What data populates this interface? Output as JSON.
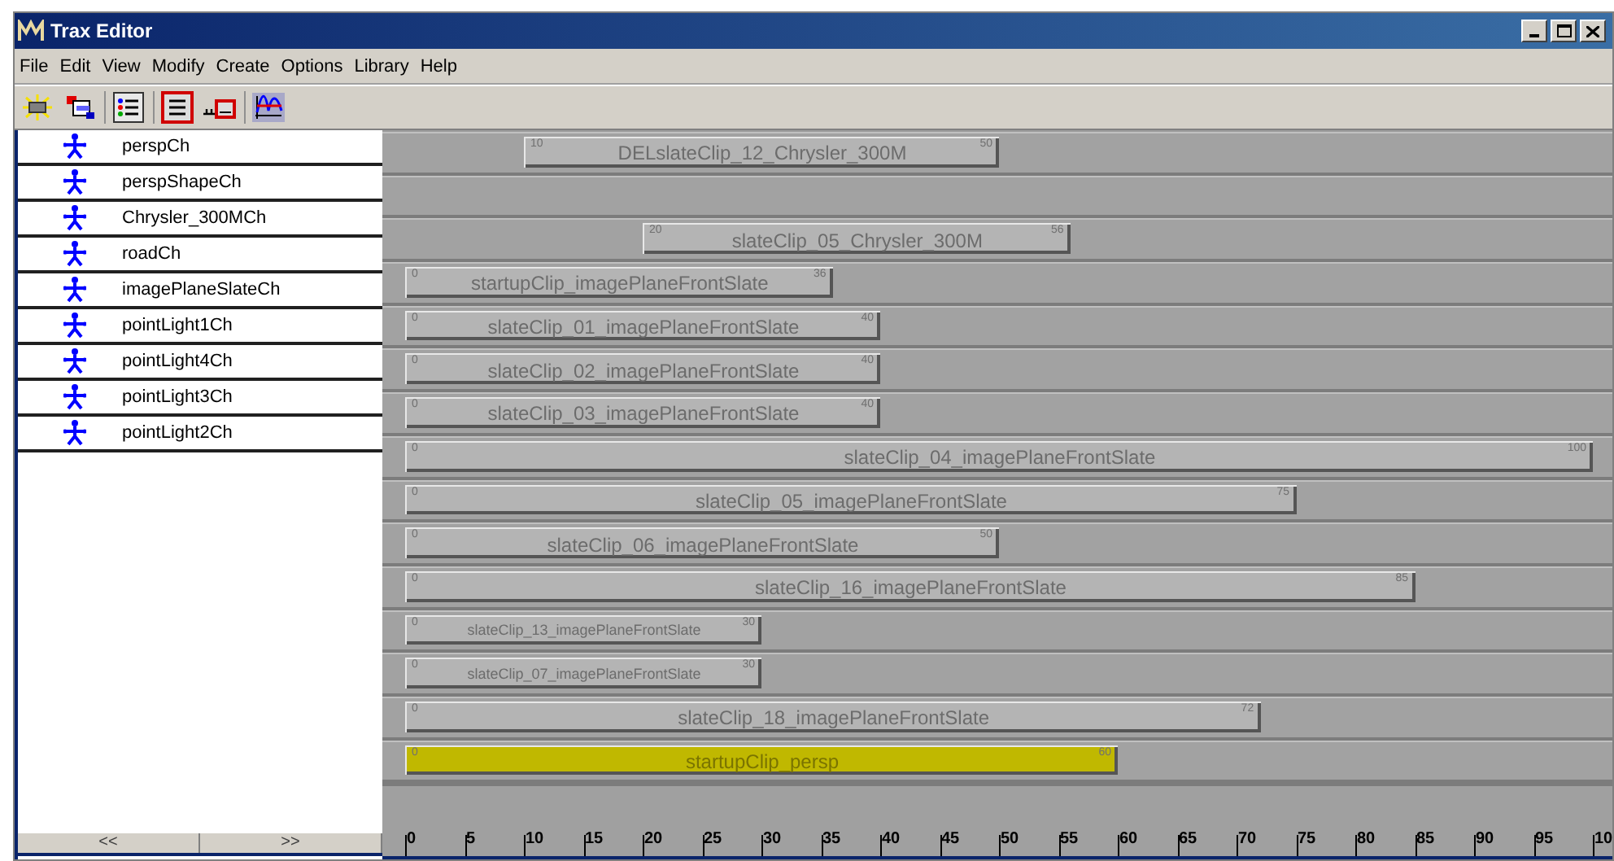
{
  "window": {
    "title": "Trax Editor"
  },
  "menu": [
    "File",
    "Edit",
    "View",
    "Modify",
    "Create",
    "Options",
    "Library",
    "Help"
  ],
  "characters": [
    "perspCh",
    "perspShapeCh",
    "Chrysler_300MCh",
    "roadCh",
    "imagePlaneSlateCh",
    "pointLight1Ch",
    "pointLight4Ch",
    "pointLight3Ch",
    "pointLight2Ch"
  ],
  "list_nav": [
    "<<",
    ">>"
  ],
  "tracks": [
    {
      "clips": [
        {
          "label": "DELslateClip_12_Chrysler_300M",
          "start": "10",
          "end": "50",
          "selected": false,
          "small": false
        }
      ]
    },
    {
      "kind": "empty"
    },
    {
      "clips": [
        {
          "label": "slateClip_05_Chrysler_300M",
          "start": "20",
          "end": "56",
          "selected": false,
          "small": false
        }
      ]
    },
    {
      "clips": [
        {
          "label": "startupClip_imagePlaneFrontSlate",
          "start": "0",
          "end": "36",
          "selected": false,
          "small": false
        }
      ]
    },
    {
      "clips": [
        {
          "label": "slateClip_01_imagePlaneFrontSlate",
          "start": "0",
          "end": "40",
          "selected": false,
          "small": false
        }
      ]
    },
    {
      "clips": [
        {
          "label": "slateClip_02_imagePlaneFrontSlate",
          "start": "0",
          "end": "40",
          "selected": false,
          "small": false
        }
      ]
    },
    {
      "clips": [
        {
          "label": "slateClip_03_imagePlaneFrontSlate",
          "start": "0",
          "end": "40",
          "selected": false,
          "small": false
        }
      ]
    },
    {
      "clips": [
        {
          "label": "slateClip_04_imagePlaneFrontSlate",
          "start": "0",
          "end": "100",
          "selected": false,
          "small": false
        }
      ]
    },
    {
      "clips": [
        {
          "label": "slateClip_05_imagePlaneFrontSlate",
          "start": "0",
          "end": "75",
          "selected": false,
          "small": false
        }
      ]
    },
    {
      "clips": [
        {
          "label": "slateClip_06_imagePlaneFrontSlate",
          "start": "0",
          "end": "50",
          "selected": false,
          "small": false
        }
      ]
    },
    {
      "clips": [
        {
          "label": "slateClip_16_imagePlaneFrontSlate",
          "start": "0",
          "end": "85",
          "selected": false,
          "small": false
        }
      ]
    },
    {
      "clips": [
        {
          "label": "slateClip_13_imagePlaneFrontSlate",
          "start": "0",
          "end": "30",
          "selected": false,
          "small": true
        }
      ]
    },
    {
      "clips": [
        {
          "label": "slateClip_07_imagePlaneFrontSlate",
          "start": "0",
          "end": "30",
          "selected": false,
          "small": true
        }
      ]
    },
    {
      "clips": [
        {
          "label": "slateClip_18_imagePlaneFrontSlate",
          "start": "0",
          "end": "72",
          "selected": false,
          "small": false
        }
      ]
    },
    {
      "clips": [
        {
          "label": "startupClip_persp",
          "start": "0",
          "end": "60",
          "selected": true,
          "small": false
        }
      ]
    }
  ],
  "ruler": [
    "0",
    "5",
    "10",
    "15",
    "20",
    "25",
    "30",
    "35",
    "40",
    "45",
    "50",
    "55",
    "60",
    "65",
    "70",
    "75",
    "80",
    "85",
    "90",
    "95",
    "10"
  ]
}
